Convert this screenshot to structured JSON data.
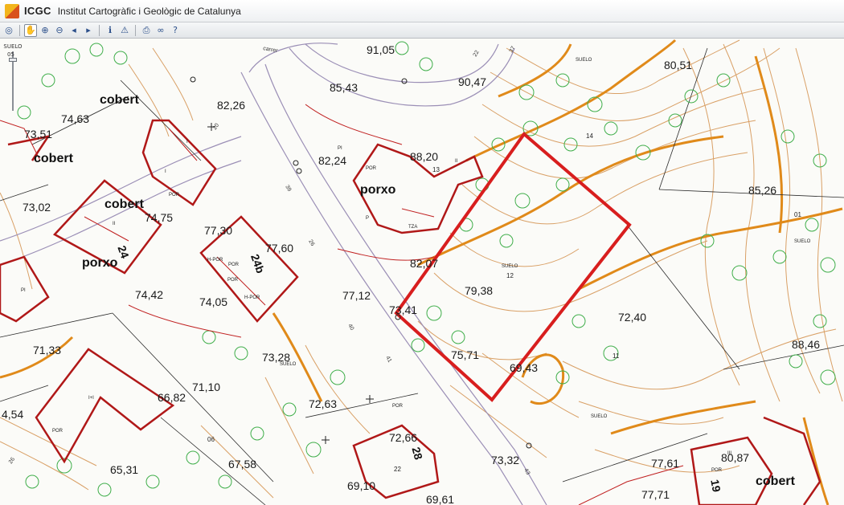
{
  "header": {
    "brand": "ICGC",
    "institution": "Institut Cartogràfic i Geològic de Catalunya"
  },
  "toolbar": {
    "tools": [
      {
        "icon": "globe-icon",
        "glyph": "◎"
      },
      {
        "icon": "pan-hand-icon",
        "glyph": "✋",
        "active": true
      },
      {
        "icon": "zoom-in-icon",
        "glyph": "⊕"
      },
      {
        "icon": "zoom-out-icon",
        "glyph": "⊖"
      },
      {
        "icon": "back-arrow-icon",
        "glyph": "◂"
      },
      {
        "icon": "forward-arrow-icon",
        "glyph": "▸"
      },
      {
        "icon": "info-icon",
        "glyph": "ℹ"
      },
      {
        "icon": "warning-icon",
        "glyph": "⚠"
      },
      {
        "icon": "print-icon",
        "glyph": "⎙"
      },
      {
        "icon": "link-icon",
        "glyph": "∞"
      },
      {
        "icon": "help-icon",
        "glyph": "?"
      }
    ]
  },
  "zoom": {
    "label": "SUELO",
    "level": "05"
  },
  "map": {
    "elevations": [
      "91,05",
      "85,43",
      "90,47",
      "80,51",
      "82,26",
      "74,63",
      "73,51",
      "82,24",
      "88,20",
      "73,02",
      "85,26",
      "74,75",
      "77,30",
      "77,60",
      "82,07",
      "79,38",
      "74,42",
      "74,05",
      "77,12",
      "73,41",
      "72,40",
      "71,33",
      "73,28",
      "75,71",
      "69,43",
      "88,46",
      "66,82",
      "71,10",
      "72,63",
      "4,54",
      "72,66",
      "73,32",
      "65,31",
      "67,58",
      "69,10",
      "77,61",
      "80,87",
      "69,61",
      "77,71"
    ],
    "labels": [
      "cobert",
      "cobert",
      "cobert",
      "porxo",
      "porxo",
      "cobert"
    ],
    "building_numbers": [
      "24",
      "24b",
      "28",
      "19"
    ],
    "small_labels": [
      "SUELO",
      "SUELO",
      "SUELO",
      "SUELO",
      "SUELO",
      "PI",
      "PI",
      "POR",
      "POR",
      "TZA",
      "P",
      "II",
      "I",
      "H-POR",
      "POR",
      "H-POR",
      "I",
      "POR",
      "I+I",
      "III",
      "POR",
      "POR",
      "II",
      "22",
      "12",
      "14",
      "11",
      "01",
      "13",
      "06",
      "carrer",
      "20",
      "22",
      "37",
      "39",
      "26",
      "41",
      "40",
      "43",
      "26",
      "POR"
    ]
  },
  "colors": {
    "plot_outline": "#d81e1e",
    "building_outline": "#b01818",
    "contour": "#d9a066",
    "contour_index": "#e08a1a",
    "vegetation": "#3fae4a",
    "road": "#9b8fb6"
  }
}
